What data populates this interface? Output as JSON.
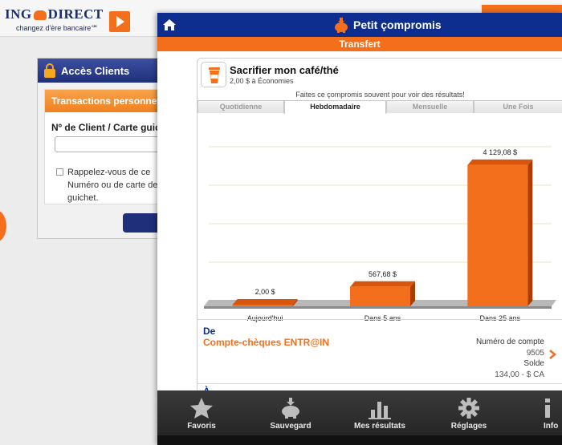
{
  "background": {
    "brand": {
      "name_left": "ING",
      "name_right": "DIRECT",
      "tagline": "changez d'ère bancaire℠"
    },
    "login": {
      "title": "Accès Clients",
      "panel_title": "Transactions personnelles",
      "client_label": "Nº de Client / Carte guichet",
      "remember_text": "Rappelez-vous de ce Numéro ou de carte de guichet."
    }
  },
  "app": {
    "title": "Petit çompromis",
    "subtitle": "Transfert",
    "sacrifice": {
      "title": "Sacrifier mon café/thé",
      "subtitle": "2,00 $ à Économies"
    },
    "hint": "Faites ce çompromis souvent pour voir des résultats!",
    "tabs": [
      {
        "label": "Quotidienne",
        "active": false
      },
      {
        "label": "Hebdomadaire",
        "active": true
      },
      {
        "label": "Mensuelle",
        "active": false
      },
      {
        "label": "Une Fois",
        "active": false
      }
    ],
    "from": {
      "label": "De",
      "account": "Compte-chèques ENTR@IN",
      "account_number_label": "Numéro de compte",
      "account_number": "9505",
      "balance_label": "Solde",
      "balance": "134,00 - $ CA"
    },
    "to": {
      "label": "À"
    },
    "nav": [
      {
        "label": "Favoris",
        "icon": "star-icon"
      },
      {
        "label": "Sauvegard",
        "icon": "piggy-bank-icon"
      },
      {
        "label": "Mes résultats",
        "icon": "bar-chart-icon"
      },
      {
        "label": "Réglages",
        "icon": "gear-icon"
      },
      {
        "label": "Info",
        "icon": "info-icon"
      }
    ]
  },
  "colors": {
    "brand_blue": "#0d2d8f",
    "brand_orange": "#f46f1b",
    "nav_dark": "#2e2e2e"
  },
  "chart_data": {
    "type": "bar",
    "categories": [
      "Aujourd'hui",
      "Dans 5 ans",
      "Dans 25 ans"
    ],
    "values": [
      2.0,
      567.68,
      4129.08
    ],
    "value_labels": [
      "2,00 $",
      "567,68 $",
      "4 129,08 $"
    ],
    "title": "",
    "xlabel": "",
    "ylabel": "",
    "ylim": [
      0,
      4500
    ],
    "grid": true,
    "bar_color": "#f46f1b"
  }
}
